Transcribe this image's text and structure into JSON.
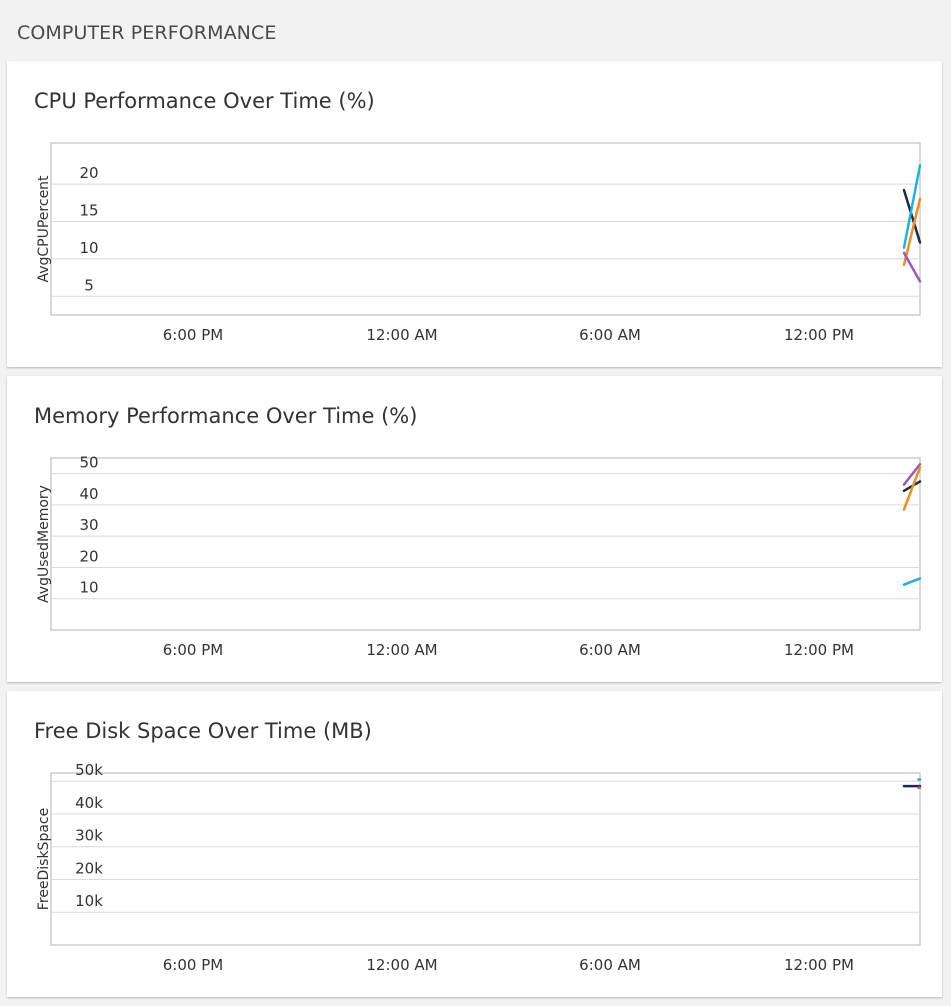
{
  "section": {
    "title": "COMPUTER PERFORMANCE"
  },
  "chart_data": [
    {
      "type": "line",
      "title": "CPU Performance Over Time (%)",
      "ylabel": "AvgCPUPercent",
      "xlabel": "",
      "x_ticks": [
        "6:00 PM",
        "12:00 AM",
        "6:00 AM",
        "12:00 PM"
      ],
      "y_ticks": [
        5,
        10,
        15,
        20
      ],
      "ylim": [
        2.5,
        25.5
      ],
      "grid": true,
      "series": [
        {
          "color": "#1a2b4a",
          "points": [
            [
              0,
              19.2
            ],
            [
              1,
              12.2
            ]
          ]
        },
        {
          "color": "#1ab4e0",
          "points": [
            [
              0,
              11.5
            ],
            [
              1,
              22.5
            ]
          ]
        },
        {
          "color": "#f08c1e",
          "points": [
            [
              0,
              9.2
            ],
            [
              1,
              18.0
            ]
          ]
        },
        {
          "color": "#9b59b6",
          "points": [
            [
              0,
              10.8
            ],
            [
              1,
              7.0
            ]
          ]
        }
      ]
    },
    {
      "type": "line",
      "title": "Memory Performance Over Time (%)",
      "ylabel": "AvgUsedMemory",
      "xlabel": "",
      "x_ticks": [
        "6:00 PM",
        "12:00 AM",
        "6:00 AM",
        "12:00 PM"
      ],
      "y_ticks": [
        10,
        20,
        30,
        40,
        50
      ],
      "ylim": [
        0,
        55
      ],
      "grid": true,
      "series": [
        {
          "color": "#9b59b6",
          "points": [
            [
              0,
              46.5
            ],
            [
              1,
              53.0
            ]
          ]
        },
        {
          "color": "#1a2b4a",
          "points": [
            [
              0,
              44.5
            ],
            [
              1,
              47.5
            ]
          ]
        },
        {
          "color": "#f08c1e",
          "points": [
            [
              0,
              38.5
            ],
            [
              1,
              52.0
            ]
          ]
        },
        {
          "color": "#1ab4e0",
          "points": [
            [
              0,
              14.5
            ],
            [
              1,
              16.5
            ]
          ]
        }
      ]
    },
    {
      "type": "line",
      "title": "Free Disk Space Over Time (MB)",
      "ylabel": "FreeDiskSpace",
      "xlabel": "",
      "x_ticks": [
        "6:00 PM",
        "12:00 AM",
        "6:00 AM",
        "12:00 PM"
      ],
      "y_ticks": [
        "10k",
        "20k",
        "30k",
        "40k",
        "50k"
      ],
      "y_tick_values": [
        10000,
        20000,
        30000,
        40000,
        50000
      ],
      "ylim": [
        0,
        52500
      ],
      "grid": true,
      "series": [
        {
          "color": "#1a2b4a",
          "points": [
            [
              0,
              48500
            ],
            [
              1,
              48500
            ]
          ]
        },
        {
          "color": "#1ab4e0",
          "points": [
            [
              0.9,
              50500
            ],
            [
              1,
              50500
            ]
          ]
        },
        {
          "color": "#e05a5a",
          "points": [
            [
              0.9,
              48000
            ],
            [
              1,
              48000
            ]
          ]
        }
      ]
    }
  ]
}
